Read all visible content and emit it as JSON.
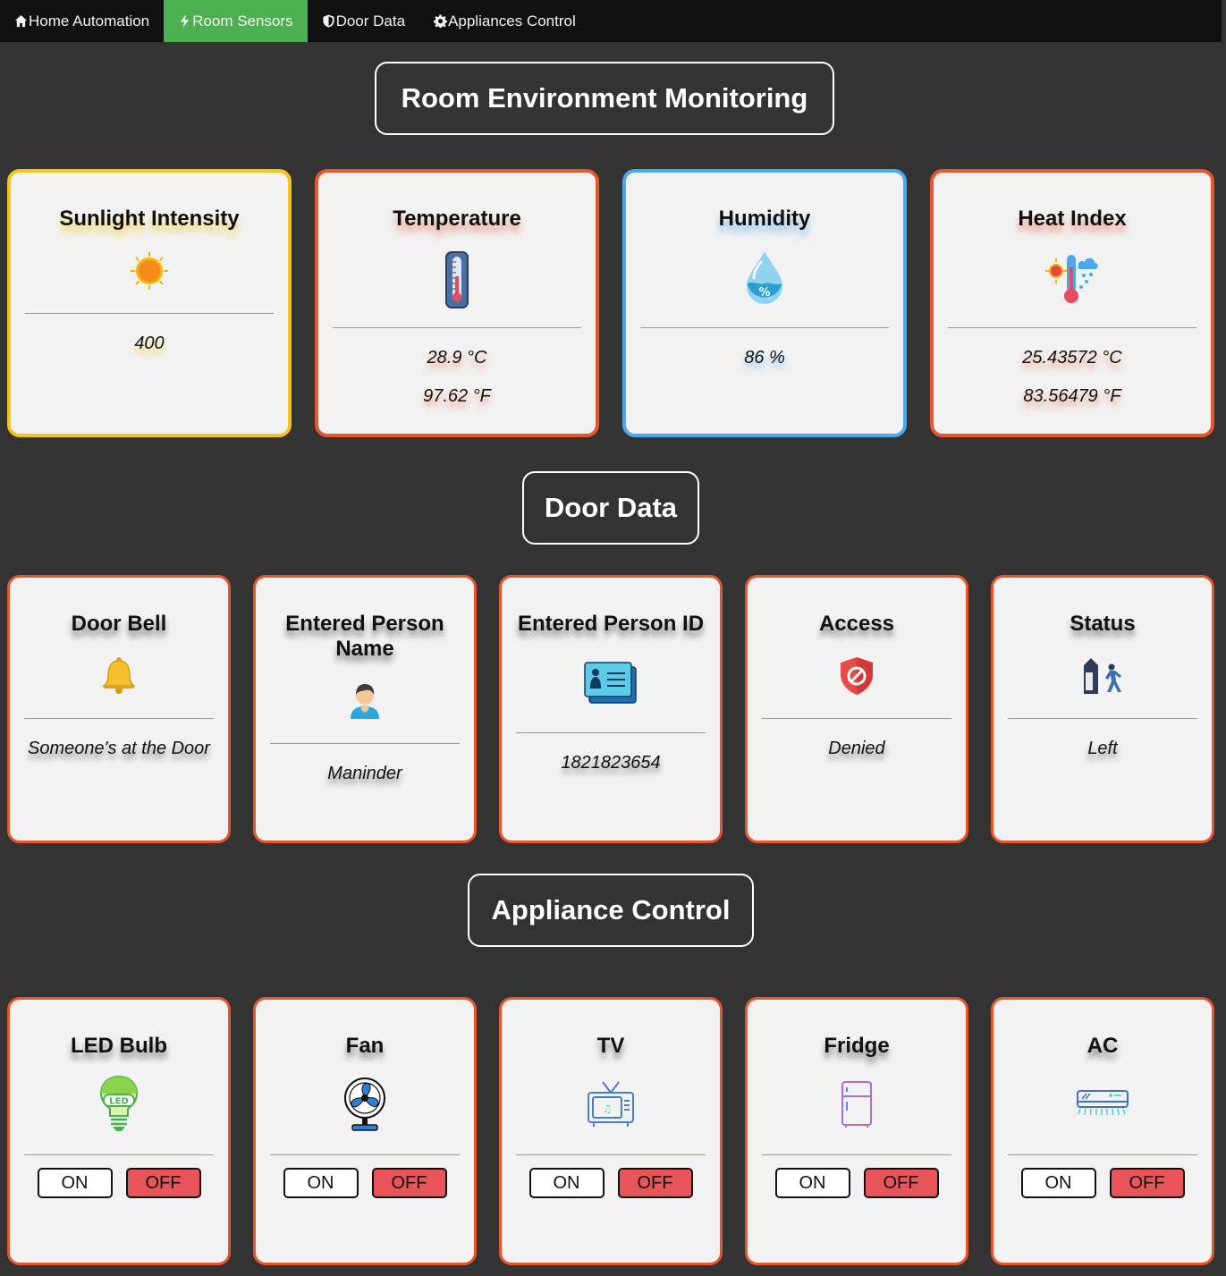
{
  "nav": {
    "items": [
      {
        "label": "Home Automation",
        "icon": "home-icon",
        "active": false
      },
      {
        "label": "Room Sensors",
        "icon": "bolt-icon",
        "active": true
      },
      {
        "label": "Door Data",
        "icon": "shield-icon",
        "active": false
      },
      {
        "label": "Appliances Control",
        "icon": "gear-icon",
        "active": false
      }
    ],
    "active_color": "#4CAF50"
  },
  "room": {
    "title": "Room Environment Monitoring",
    "cards": [
      {
        "title": "Sunlight Intensity",
        "icon": "sun-icon",
        "values": [
          "400"
        ],
        "accent": "#f5c518"
      },
      {
        "title": "Temperature",
        "icon": "thermometer-icon",
        "values": [
          "28.9 °C",
          "97.62 °F"
        ],
        "accent": "#e8542c"
      },
      {
        "title": "Humidity",
        "icon": "humidity-drop-icon",
        "values": [
          "86 %"
        ],
        "accent": "#4aa8f0"
      },
      {
        "title": "Heat Index",
        "icon": "heat-index-icon",
        "values": [
          "25.43572 °C",
          "83.56479 °F"
        ],
        "accent": "#e8542c"
      }
    ]
  },
  "door": {
    "title": "Door Data",
    "cards": [
      {
        "title": "Door Bell",
        "icon": "bell-icon",
        "value": "Someone's at the Door"
      },
      {
        "title": "Entered Person Name",
        "icon": "person-icon",
        "value": "Maninder"
      },
      {
        "title": "Entered Person ID",
        "icon": "id-card-icon",
        "value": "1821823654"
      },
      {
        "title": "Access",
        "icon": "access-denied-shield-icon",
        "value": "Denied"
      },
      {
        "title": "Status",
        "icon": "person-leaving-door-icon",
        "value": "Left"
      }
    ],
    "accent": "#e8542c"
  },
  "appliances": {
    "title": "Appliance Control",
    "on_label": "ON",
    "off_label": "OFF",
    "cards": [
      {
        "title": "LED Bulb",
        "icon": "led-bulb-icon"
      },
      {
        "title": "Fan",
        "icon": "fan-icon"
      },
      {
        "title": "TV",
        "icon": "tv-icon"
      },
      {
        "title": "Fridge",
        "icon": "fridge-icon"
      },
      {
        "title": "AC",
        "icon": "air-conditioner-icon"
      }
    ],
    "accent": "#e8542c",
    "off_color": "#e8545a"
  }
}
